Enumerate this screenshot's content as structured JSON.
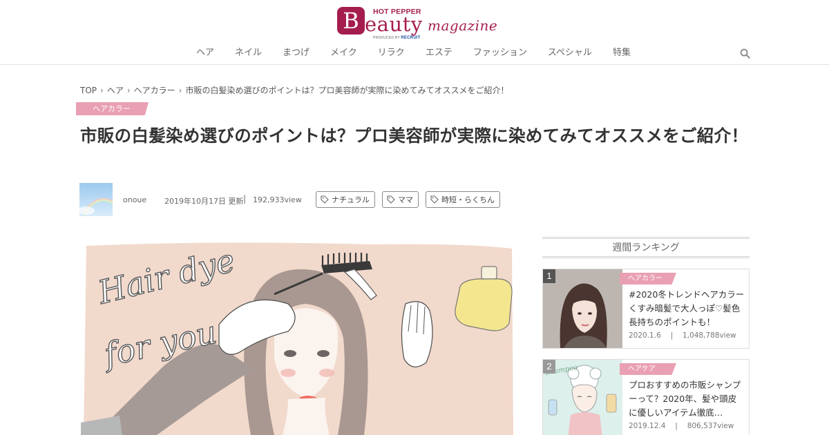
{
  "logo": {
    "brand_small": "HOT PEPPER",
    "letter": "B",
    "brand_main": "eauty",
    "brand_sub": "magazine",
    "produced_by": "PRODUCED BY",
    "company": "RECRUIT"
  },
  "nav": {
    "items": [
      "ヘア",
      "ネイル",
      "まつげ",
      "メイク",
      "リラク",
      "エステ",
      "ファッション",
      "スペシャル",
      "特集"
    ]
  },
  "breadcrumb": {
    "items": [
      "TOP",
      "ヘア",
      "ヘアカラー",
      "市販の白髪染め選びのポイントは？プロ美容師が実際に染めてみてオススメをご紹介！"
    ]
  },
  "article": {
    "category": "ヘアカラー",
    "title": "市販の白髪染め選びのポイントは？プロ美容師が実際に染めてみてオススメをご紹介！",
    "author": "onoue",
    "date": "2019年10月17日 更新",
    "separator": "|",
    "views": "192,933view",
    "tags": [
      "ナチュラル",
      "ママ",
      "時短・らくちん"
    ],
    "hero_text_line1": "Hair dye",
    "hero_text_line2": "for you"
  },
  "sidebar": {
    "ranking_title": "週間ランキング",
    "items": [
      {
        "rank": "1",
        "category": "ヘアカラー",
        "title": "#2020冬トレンドヘアカラー くすみ暗髪で大人っぽ♡髪色長持ちのポイントも！",
        "date": "2020.1.6",
        "views": "1,048,788view"
      },
      {
        "rank": "2",
        "category": "ヘアケア",
        "title": "プロおすすめの市販シャンプーって？2020年、髪や頭皮に優しいアイテム徹底…",
        "date": "2019.12.4",
        "views": "806,537view"
      }
    ]
  },
  "colors": {
    "brand": "#a51d4f",
    "accent_pink": "#e9a0b3",
    "rank1_badge": "#555555",
    "rank2_badge": "#999999"
  }
}
